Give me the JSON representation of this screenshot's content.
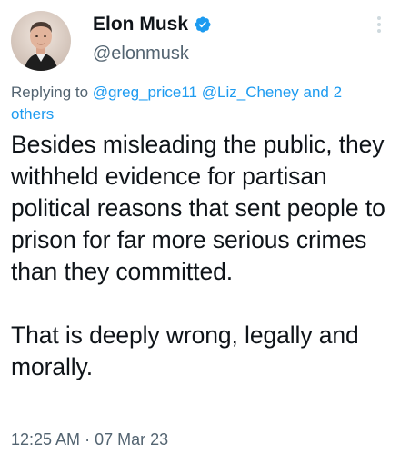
{
  "author": {
    "display_name": "Elon Musk",
    "handle": "@elonmusk",
    "verified": true
  },
  "reply_context": {
    "prefix": "Replying to ",
    "mention_1": "@greg_price11",
    "separator": " ",
    "mention_2": "@Liz_Cheney",
    "suffix": " and 2 others"
  },
  "tweet": {
    "paragraph_1": "Besides misleading the public, they withheld evidence for partisan political reasons that sent people to prison for far more serious crimes than they committed.",
    "paragraph_2": "That is deeply wrong, legally and morally."
  },
  "meta": {
    "time": "12:25 AM",
    "dot": " · ",
    "date": "07 Mar 23"
  },
  "icons": {
    "avatar": "profile-photo",
    "verified": "verified-badge-icon",
    "more": "more-options-icon"
  },
  "colors": {
    "link": "#1d9bf0",
    "secondary_text": "#536471",
    "primary_text": "#0f1419",
    "verified_badge": "#1d9bf0"
  }
}
